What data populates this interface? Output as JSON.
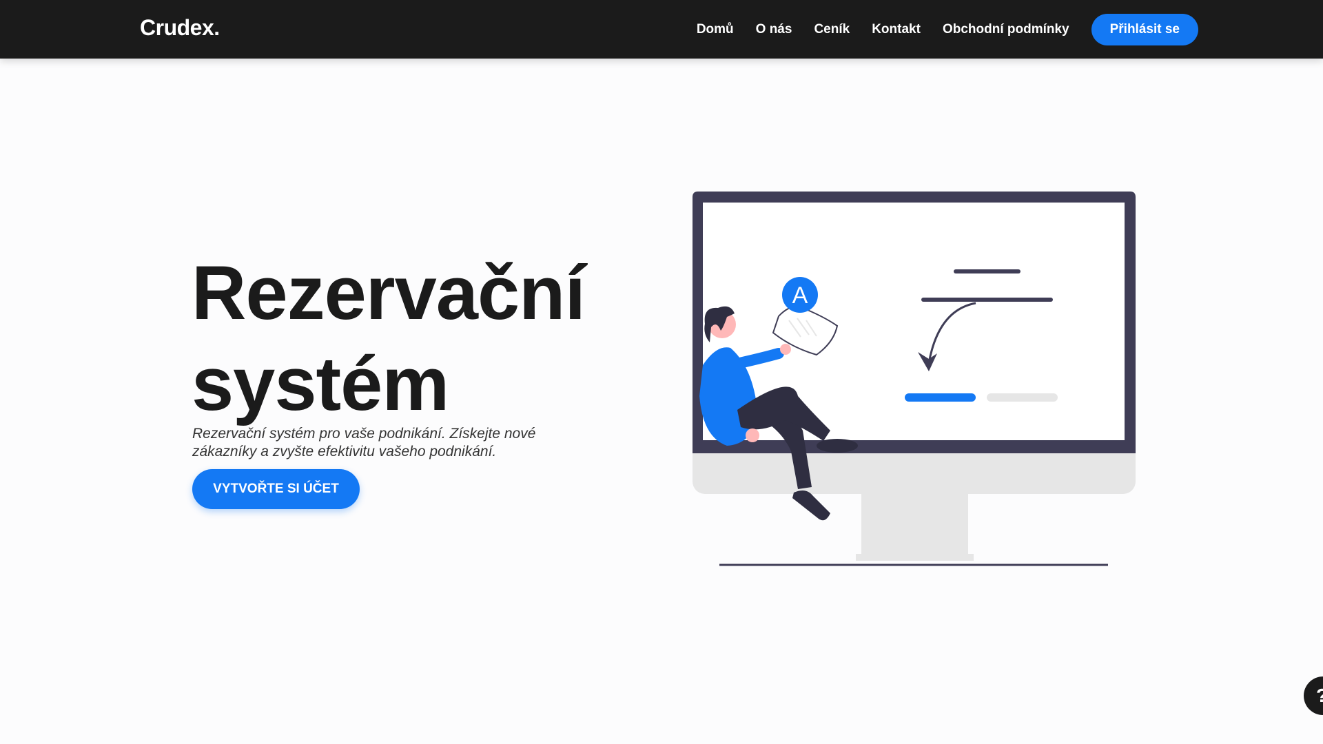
{
  "header": {
    "logo": "Crudex.",
    "nav": [
      "Domů",
      "O nás",
      "Ceník",
      "Kontakt",
      "Obchodní podmínky"
    ],
    "login_label": "Přihlásit se"
  },
  "hero": {
    "title_line1": "Rezervační",
    "title_line2": "systém",
    "description": "Rezervační systém pro vaše podnikání. Získejte nové zákazníky a zvyšte efektivitu vašeho podnikání.",
    "cta_label": "VYTVOŘTE SI ÚČET"
  },
  "illustration": {
    "avatar_letter": "A"
  },
  "help": {
    "label": "?"
  },
  "colors": {
    "accent": "#1479f4",
    "navbar": "#1b1b1b",
    "background": "#fcfcfd",
    "monitor_frame": "#3f3d56"
  }
}
